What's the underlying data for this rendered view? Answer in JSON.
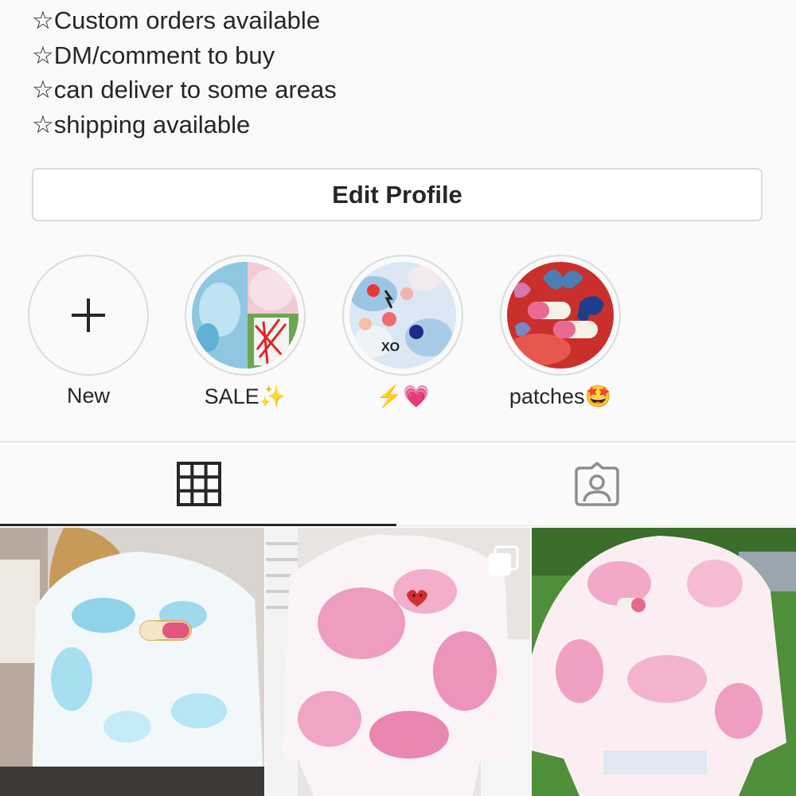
{
  "profile": {
    "bio": [
      "☆Custom orders available",
      "☆DM/comment to buy",
      "☆can deliver to some areas",
      "☆shipping available"
    ],
    "edit_button_label": "Edit Profile"
  },
  "highlights": [
    {
      "label": "New",
      "icon": "plus-icon"
    },
    {
      "label": "SALE✨",
      "icon": "tie-dye-shirt-thumbnail"
    },
    {
      "label": "⚡️💗",
      "icon": "heart-patches-thumbnail"
    },
    {
      "label": "patches🤩",
      "icon": "butterfly-patches-thumbnail"
    }
  ],
  "tabs": [
    {
      "name": "posts-grid",
      "icon": "grid-icon",
      "active": true
    },
    {
      "name": "tagged",
      "icon": "tagged-person-icon",
      "active": false
    }
  ],
  "posts": [
    {
      "description": "blue tie-dye sweatshirt with pill patch",
      "multiple": false
    },
    {
      "description": "pink tie-dye sweatshirt with heart patch",
      "multiple": true
    },
    {
      "description": "pink tie-dye sweatshirt with pill patch outdoors",
      "multiple": false
    }
  ],
  "colors": {
    "text": "#262626",
    "border": "#dbdbdb",
    "background": "#fafafa"
  }
}
